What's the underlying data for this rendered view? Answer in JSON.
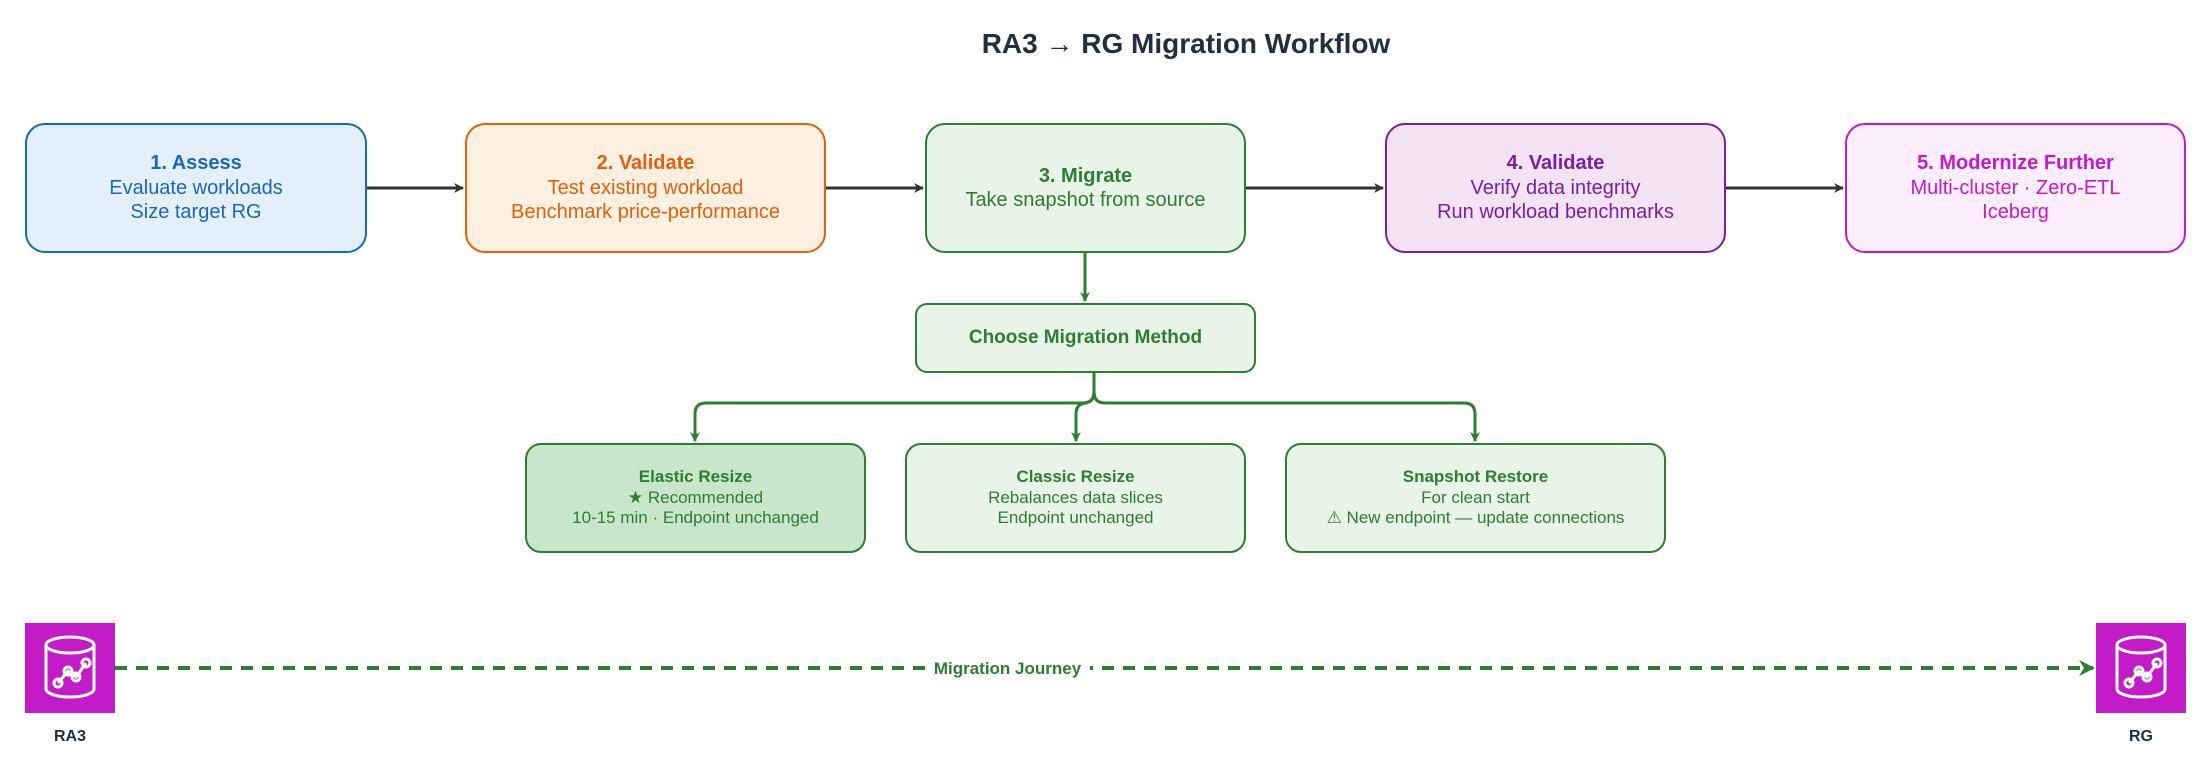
{
  "title": "RA3 → RG Migration Workflow",
  "steps": [
    {
      "heading": "1. Assess",
      "lines": [
        "Evaluate workloads",
        "Size target RG"
      ],
      "color": "#1b68b8"
    },
    {
      "heading": "2. Validate",
      "lines": [
        "Test existing workload",
        "Benchmark price-performance"
      ],
      "color": "#e0620d"
    },
    {
      "heading": "3. Migrate",
      "lines": [
        "Take snapshot from source"
      ],
      "color": "#2e7d32"
    },
    {
      "heading": "4. Validate",
      "lines": [
        "Verify data integrity",
        "Run workload benchmarks"
      ],
      "color": "#7b1fa2"
    },
    {
      "heading": "5. Modernize Further",
      "lines": [
        "Multi-cluster · Zero-ETL",
        "Iceberg"
      ],
      "color": "#c21bc7"
    }
  ],
  "decision": {
    "label": "Choose Migration Method"
  },
  "methods": [
    {
      "heading": "Elastic Resize",
      "lines": [
        "★ Recommended",
        "10-15 min · Endpoint unchanged"
      ]
    },
    {
      "heading": "Classic Resize",
      "lines": [
        "Rebalances data slices",
        "Endpoint unchanged"
      ]
    },
    {
      "heading": "Snapshot Restore",
      "lines": [
        "For clean start",
        "⚠ New endpoint — update connections"
      ]
    }
  ],
  "journey": {
    "source_label": "RA3",
    "target_label": "RG",
    "label": "Migration Journey",
    "icon": "database-icon"
  },
  "colors": {
    "arrow": "#333333",
    "green": "#2e7d32",
    "icon_bg": "#c21bc7"
  }
}
